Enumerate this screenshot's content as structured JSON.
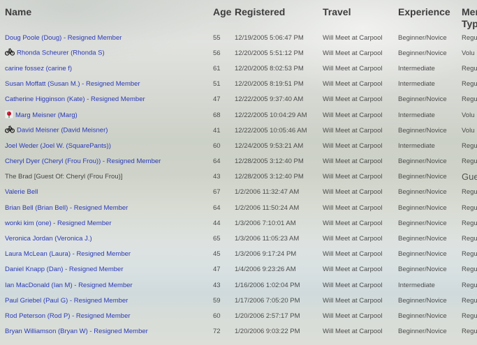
{
  "columns": {
    "name": "Name",
    "age": "Age",
    "registered": "Registered",
    "travel": "Travel",
    "experience": "Experience",
    "type_line1": "Mer",
    "type_line2": "Typ"
  },
  "rows": [
    {
      "name": "Doug Poole (Doug) - Resigned Member",
      "icon": "",
      "age": "55",
      "registered": "12/19/2005 5:06:47 PM",
      "travel": "Will Meet at Carpool",
      "experience": "Beginner/Novice",
      "type": "Regu"
    },
    {
      "name": "Rhonda Scheurer (Rhonda S)",
      "icon": "bicycle-icon",
      "age": "56",
      "registered": "12/20/2005 5:51:12 PM",
      "travel": "Will Meet at Carpool",
      "experience": "Beginner/Novice",
      "type": "Volu"
    },
    {
      "name": "carine fossez (carine f)",
      "icon": "",
      "age": "61",
      "registered": "12/20/2005 8:02:53 PM",
      "travel": "Will Meet at Carpool",
      "experience": "Intermediate",
      "type": "Regu"
    },
    {
      "name": "Susan Moffatt (Susan M.) - Resigned Member",
      "icon": "",
      "age": "51",
      "registered": "12/20/2005 8:19:51 PM",
      "travel": "Will Meet at Carpool",
      "experience": "Intermediate",
      "type": "Regu"
    },
    {
      "name": "Catherine Higginson (Kate) - Resigned Member",
      "icon": "",
      "age": "47",
      "registered": "12/22/2005 9:37:40 AM",
      "travel": "Will Meet at Carpool",
      "experience": "Beginner/Novice",
      "type": "Regu"
    },
    {
      "name": "Marg Meisner (Marg)",
      "icon": "flower-icon",
      "age": "68",
      "registered": "12/22/2005 10:04:29 AM",
      "travel": "Will Meet at Carpool",
      "experience": "Intermediate",
      "type": "Volu"
    },
    {
      "name": "David Meisner (David Meisner)",
      "icon": "bicycle-icon",
      "age": "41",
      "registered": "12/22/2005 10:05:46 AM",
      "travel": "Will Meet at Carpool",
      "experience": "Beginner/Novice",
      "type": "Volu"
    },
    {
      "name": "Joel Weder (Joel W. (SquarePants))",
      "icon": "",
      "age": "60",
      "registered": "12/24/2005 9:53:21 AM",
      "travel": "Will Meet at Carpool",
      "experience": "Intermediate",
      "type": "Regu"
    },
    {
      "name": "Cheryl Dyer (Cheryl (Frou Frou)) - Resigned Member",
      "icon": "",
      "age": "64",
      "registered": "12/28/2005 3:12:40 PM",
      "travel": "Will Meet at Carpool",
      "experience": "Beginner/Novice",
      "type": "Regu"
    },
    {
      "name": "The Brad [Guest Of: Cheryl (Frou Frou)]",
      "icon": "",
      "guest": true,
      "age": "43",
      "registered": "12/28/2005 3:12:40 PM",
      "travel": "Will Meet at Carpool",
      "experience": "Beginner/Novice",
      "type": "Gue"
    },
    {
      "name": "Valerie Bell",
      "icon": "",
      "age": "67",
      "registered": "1/2/2006 11:32:47 AM",
      "travel": "Will Meet at Carpool",
      "experience": "Beginner/Novice",
      "type": "Regu"
    },
    {
      "name": "Brian Bell (Brian Bell) - Resigned Member",
      "icon": "",
      "age": "64",
      "registered": "1/2/2006 11:50:24 AM",
      "travel": "Will Meet at Carpool",
      "experience": "Beginner/Novice",
      "type": "Regu"
    },
    {
      "name": "wonki kim (one) - Resigned Member",
      "icon": "",
      "age": "44",
      "registered": "1/3/2006 7:10:01 AM",
      "travel": "Will Meet at Carpool",
      "experience": "Beginner/Novice",
      "type": "Regu"
    },
    {
      "name": "Veronica Jordan (Veronica J.)",
      "icon": "",
      "age": "65",
      "registered": "1/3/2006 11:05:23 AM",
      "travel": "Will Meet at Carpool",
      "experience": "Beginner/Novice",
      "type": "Regu"
    },
    {
      "name": "Laura McLean (Laura) - Resigned Member",
      "icon": "",
      "age": "45",
      "registered": "1/3/2006 9:17:24 PM",
      "travel": "Will Meet at Carpool",
      "experience": "Beginner/Novice",
      "type": "Regu"
    },
    {
      "name": "Daniel Knapp (Dan) - Resigned Member",
      "icon": "",
      "age": "47",
      "registered": "1/4/2006 9:23:26 AM",
      "travel": "Will Meet at Carpool",
      "experience": "Beginner/Novice",
      "type": "Regu"
    },
    {
      "name": "Ian MacDonald (Ian M) - Resigned Member",
      "icon": "",
      "age": "43",
      "registered": "1/16/2006 1:02:04 PM",
      "travel": "Will Meet at Carpool",
      "experience": "Intermediate",
      "type": "Regu"
    },
    {
      "name": "Paul Griebel (Paul G) - Resigned Member",
      "icon": "",
      "age": "59",
      "registered": "1/17/2006 7:05:20 PM",
      "travel": "Will Meet at Carpool",
      "experience": "Beginner/Novice",
      "type": "Regu"
    },
    {
      "name": "Rod Peterson (Rod P) - Resigned Member",
      "icon": "",
      "age": "60",
      "registered": "1/20/2006 2:57:17 PM",
      "travel": "Will Meet at Carpool",
      "experience": "Beginner/Novice",
      "type": "Regu"
    },
    {
      "name": "Bryan Williamson (Bryan W) - Resigned Member",
      "icon": "",
      "age": "72",
      "registered": "1/20/2006 9:03:22 PM",
      "travel": "Will Meet at Carpool",
      "experience": "Beginner/Novice",
      "type": "Regu"
    }
  ]
}
